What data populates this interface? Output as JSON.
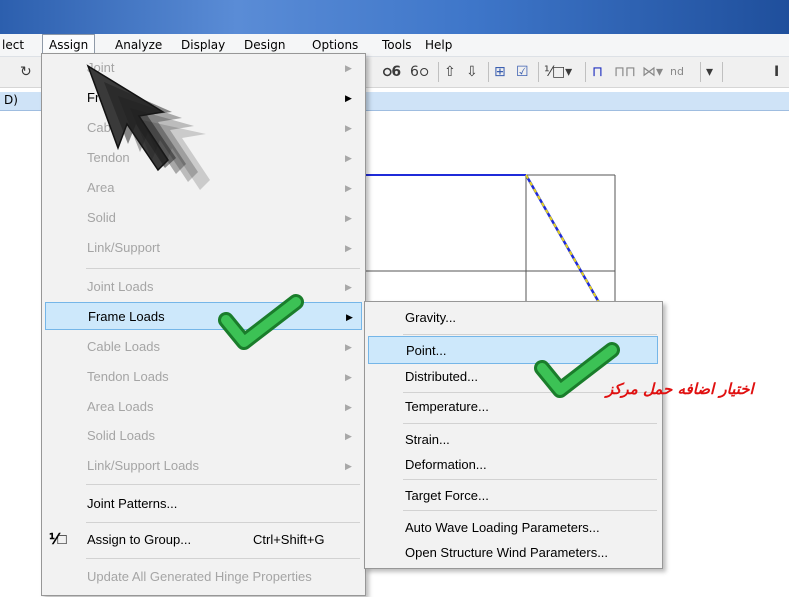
{
  "menubar": {
    "items": [
      "lect",
      "Assign",
      "Analyze",
      "Display",
      "Design",
      "Options",
      "Tools",
      "Help"
    ]
  },
  "toolbar": {
    "icons": [
      "refresh-icon",
      "binoculars-icon",
      "arrow-up-icon",
      "arrow-down-icon",
      "grid-icon",
      "checkbox-icon",
      "fraction-icon",
      "frame-icon",
      "portal-icon",
      "truss-icon",
      "beam-icon"
    ],
    "nd_label": "nd"
  },
  "panel": {
    "title": "D)"
  },
  "assign_menu": {
    "items": [
      {
        "label": "Joint",
        "enabled": false,
        "arrow": true
      },
      {
        "label": "Frame",
        "enabled": true,
        "arrow": true
      },
      {
        "label": "Cable",
        "enabled": false,
        "arrow": true
      },
      {
        "label": "Tendon",
        "enabled": false,
        "arrow": true
      },
      {
        "label": "Area",
        "enabled": false,
        "arrow": true
      },
      {
        "label": "Solid",
        "enabled": false,
        "arrow": true
      },
      {
        "label": "Link/Support",
        "enabled": false,
        "arrow": true
      },
      {
        "label": "Joint Loads",
        "enabled": false,
        "arrow": true
      },
      {
        "label": "Frame Loads",
        "enabled": true,
        "arrow": true,
        "highlighted": true
      },
      {
        "label": "Cable Loads",
        "enabled": false,
        "arrow": true
      },
      {
        "label": "Tendon Loads",
        "enabled": false,
        "arrow": true
      },
      {
        "label": "Area Loads",
        "enabled": false,
        "arrow": true
      },
      {
        "label": "Solid Loads",
        "enabled": false,
        "arrow": true
      },
      {
        "label": "Link/Support Loads",
        "enabled": false,
        "arrow": true
      },
      {
        "label": "Joint Patterns...",
        "enabled": true
      },
      {
        "label": "Assign to Group...",
        "enabled": true,
        "shortcut": "Ctrl+Shift+G"
      },
      {
        "label": "Update All Generated Hinge Properties",
        "enabled": false
      }
    ]
  },
  "frame_loads_submenu": {
    "items": [
      {
        "label": "Gravity..."
      },
      {
        "label": "Point...",
        "highlighted": true
      },
      {
        "label": "Distributed..."
      },
      {
        "label": "Temperature..."
      },
      {
        "label": "Strain..."
      },
      {
        "label": "Deformation..."
      },
      {
        "label": "Target Force..."
      },
      {
        "label": "Auto Wave Loading Parameters..."
      },
      {
        "label": "Open Structure Wind Parameters..."
      }
    ]
  },
  "annotation": {
    "text": "اختیار اضافه حمل مرکز",
    "color": "#e01010"
  },
  "colors": {
    "highlight": "#cde8fb",
    "highlight_border": "#75b6e8",
    "checkmark": "#22a03a",
    "frame_line": "#1f2bd9",
    "dashed_line": "#e6d31a"
  }
}
